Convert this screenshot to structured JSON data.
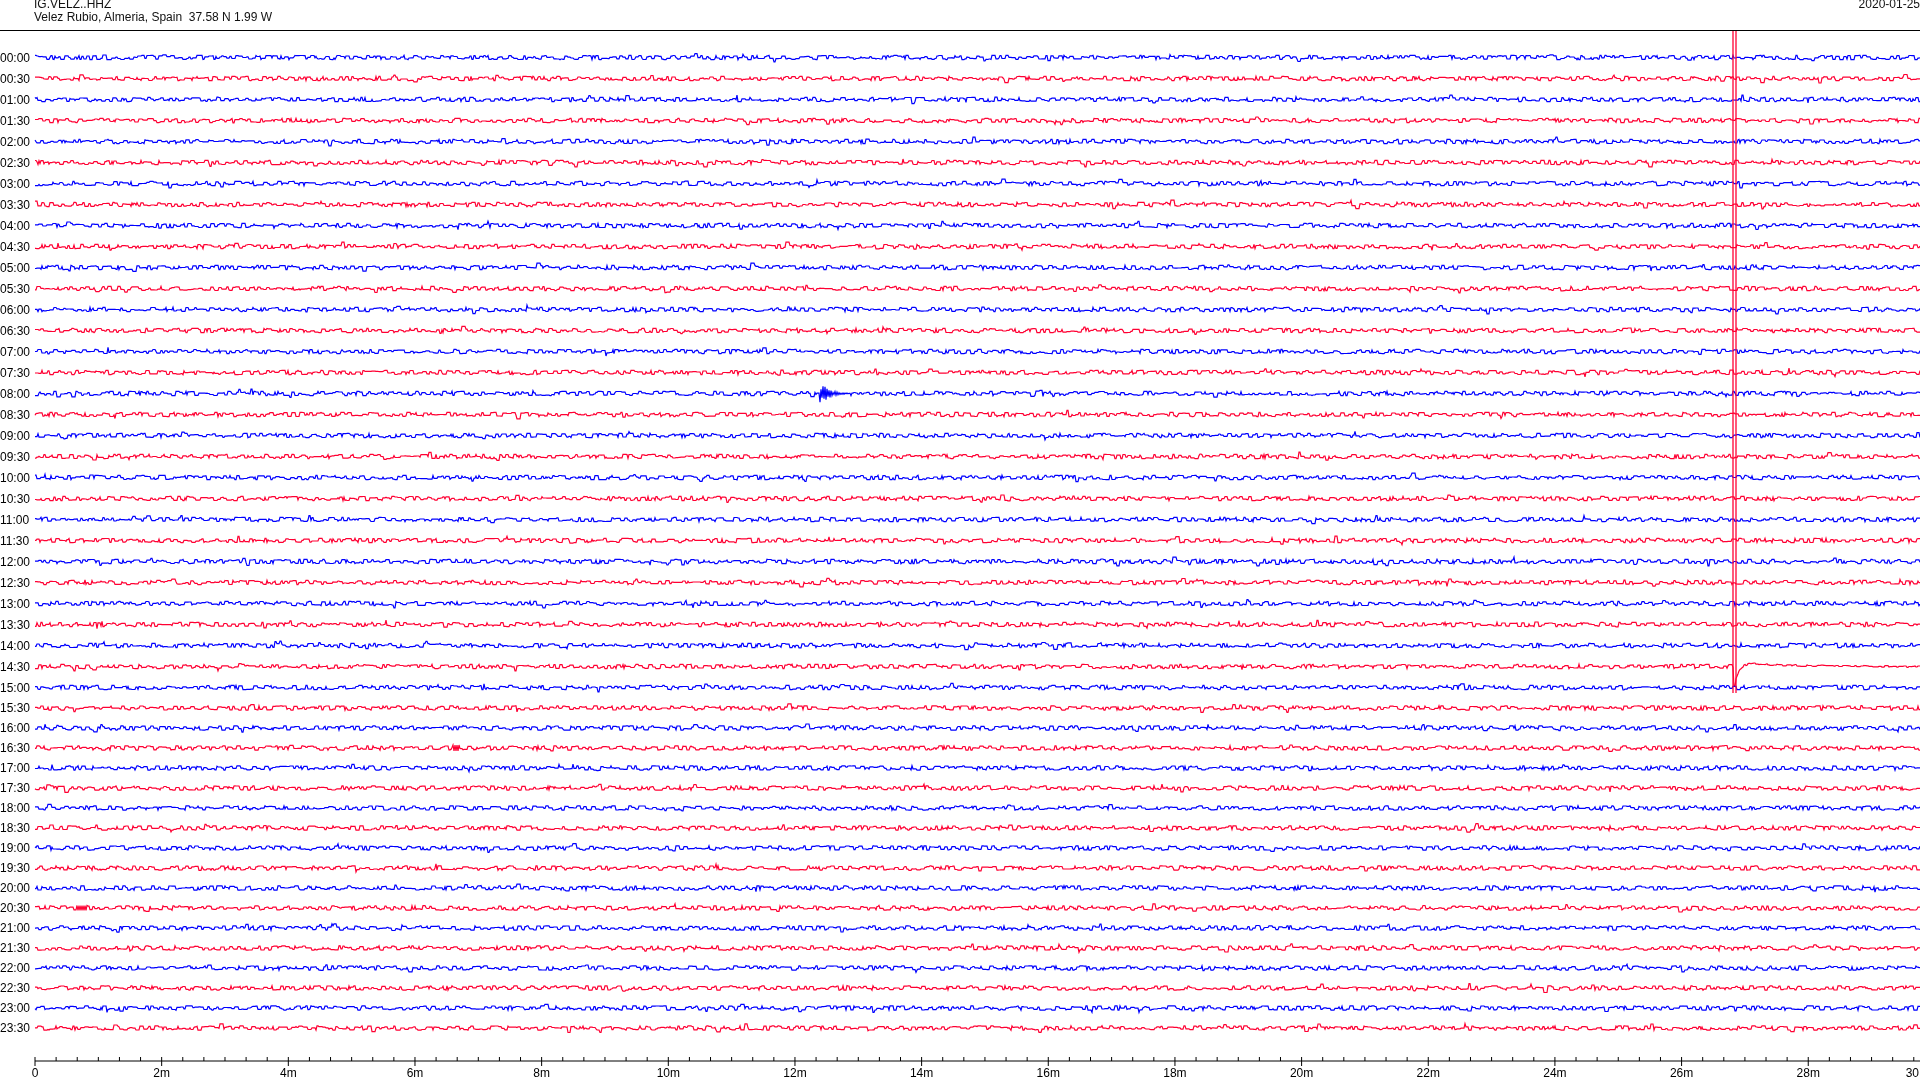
{
  "header": {
    "station": "IG.VELZ..HHZ",
    "location": "Velez Rubio, Almeria, Spain  37.58 N 1.99 W",
    "date": "2020-01-25"
  },
  "rows": [
    {
      "label": "00:00",
      "color": "#0000ff"
    },
    {
      "label": "00:30",
      "color": "#ff0033"
    },
    {
      "label": "01:00",
      "color": "#0000ff"
    },
    {
      "label": "01:30",
      "color": "#ff0033"
    },
    {
      "label": "02:00",
      "color": "#0000ff"
    },
    {
      "label": "02:30",
      "color": "#ff0033"
    },
    {
      "label": "03:00",
      "color": "#0000ff"
    },
    {
      "label": "03:30",
      "color": "#ff0033"
    },
    {
      "label": "04:00",
      "color": "#0000ff"
    },
    {
      "label": "04:30",
      "color": "#ff0033"
    },
    {
      "label": "05:00",
      "color": "#0000ff"
    },
    {
      "label": "05:30",
      "color": "#ff0033"
    },
    {
      "label": "06:00",
      "color": "#0000ff"
    },
    {
      "label": "06:30",
      "color": "#ff0033"
    },
    {
      "label": "07:00",
      "color": "#0000ff"
    },
    {
      "label": "07:30",
      "color": "#ff0033"
    },
    {
      "label": "08:00",
      "color": "#0000ff"
    },
    {
      "label": "08:30",
      "color": "#ff0033"
    },
    {
      "label": "09:00",
      "color": "#0000ff"
    },
    {
      "label": "09:30",
      "color": "#ff0033"
    },
    {
      "label": "10:00",
      "color": "#0000ff"
    },
    {
      "label": "10:30",
      "color": "#ff0033"
    },
    {
      "label": "11:00",
      "color": "#0000ff"
    },
    {
      "label": "11:30",
      "color": "#ff0033"
    },
    {
      "label": "12:00",
      "color": "#0000ff"
    },
    {
      "label": "12:30",
      "color": "#ff0033"
    },
    {
      "label": "13:00",
      "color": "#0000ff"
    },
    {
      "label": "13:30",
      "color": "#ff0033"
    },
    {
      "label": "14:00",
      "color": "#0000ff"
    },
    {
      "label": "14:30",
      "color": "#ff0033"
    },
    {
      "label": "15:00",
      "color": "#0000ff"
    },
    {
      "label": "15:30",
      "color": "#ff0033"
    },
    {
      "label": "16:00",
      "color": "#0000ff"
    },
    {
      "label": "16:30",
      "color": "#ff0033"
    },
    {
      "label": "17:00",
      "color": "#0000ff"
    },
    {
      "label": "17:30",
      "color": "#ff0033"
    },
    {
      "label": "18:00",
      "color": "#0000ff"
    },
    {
      "label": "18:30",
      "color": "#ff0033"
    },
    {
      "label": "19:00",
      "color": "#0000ff"
    },
    {
      "label": "19:30",
      "color": "#ff0033"
    },
    {
      "label": "20:00",
      "color": "#0000ff"
    },
    {
      "label": "20:30",
      "color": "#ff0033"
    },
    {
      "label": "21:00",
      "color": "#0000ff"
    },
    {
      "label": "21:30",
      "color": "#ff0033"
    },
    {
      "label": "22:00",
      "color": "#0000ff"
    },
    {
      "label": "22:30",
      "color": "#ff0033"
    },
    {
      "label": "23:00",
      "color": "#0000ff"
    },
    {
      "label": "23:30",
      "color": "#ff0033"
    }
  ],
  "x_axis_labels": [
    "0",
    "2m",
    "4m",
    "6m",
    "8m",
    "10m",
    "12m",
    "14m",
    "16m",
    "18m",
    "20m",
    "22m",
    "24m",
    "26m",
    "28m",
    "30"
  ]
}
